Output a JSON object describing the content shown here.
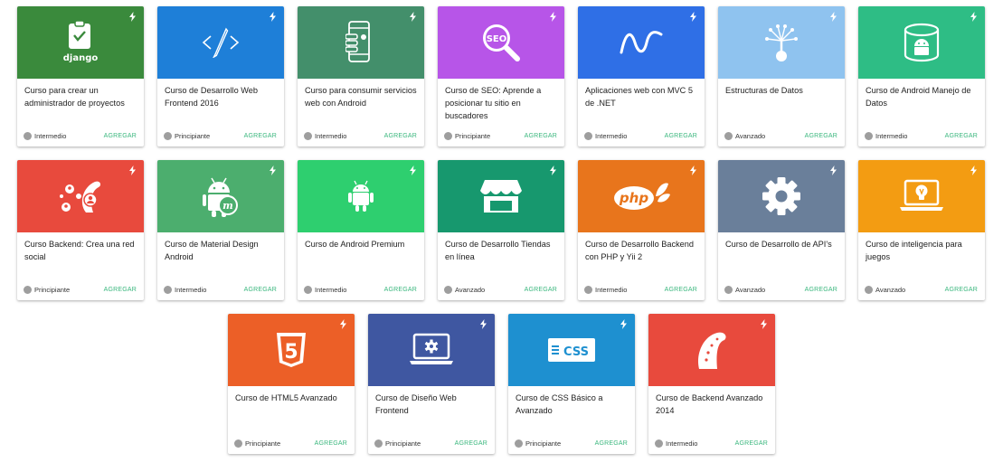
{
  "colors": {
    "django": "#3a8a3c",
    "frontend": "#1e7fd8",
    "android_consume": "#438f6b",
    "seo": "#b755e8",
    "mvc": "#2f6fe6",
    "data": "#8fc3ef",
    "android_data": "#2ebd85",
    "backend_social": "#e84a3d",
    "material": "#4cae6e",
    "android_premium": "#2ecf6f",
    "stores": "#17986e",
    "php": "#e8751c",
    "api": "#6a7f9a",
    "ai_games": "#f39c12",
    "html5": "#ec5f27",
    "design": "#3f57a1",
    "css": "#1e90d0",
    "backend_2014": "#e84a3d",
    "add_button": "#3bb77e",
    "level_dot": "#9e9e9e"
  },
  "courses": [
    {
      "title": "Curso para crear un administrador de proyectos",
      "level": "Intermedio",
      "action": "AGREGAR",
      "icon": "django-icon",
      "icon_text": "django",
      "color": "#3a8a3c"
    },
    {
      "title": "Curso de Desarrollo Web Frontend 2016",
      "level": "Principiante",
      "action": "AGREGAR",
      "icon": "code-pen-icon",
      "color": "#1e7fd8"
    },
    {
      "title": "Curso para consumir servicios web con Android",
      "level": "Intermedio",
      "action": "AGREGAR",
      "icon": "phone-icon",
      "color": "#438f6b"
    },
    {
      "title": "Curso de SEO: Aprende a posicionar tu sitio en buscadores",
      "level": "Principiante",
      "action": "AGREGAR",
      "icon": "seo-magnifier-icon",
      "icon_text": "SEO",
      "color": "#b755e8"
    },
    {
      "title": "Aplicaciones web con MVC 5 de .NET",
      "level": "Intermedio",
      "action": "AGREGAR",
      "icon": "wave-icon",
      "color": "#2f6fe6"
    },
    {
      "title": "Estructuras de Datos",
      "level": "Avanzado",
      "action": "AGREGAR",
      "icon": "tree-nodes-icon",
      "color": "#8fc3ef"
    },
    {
      "title": "Curso de Android Manejo de Datos",
      "level": "Intermedio",
      "action": "AGREGAR",
      "icon": "android-database-icon",
      "color": "#2ebd85"
    },
    {
      "title": "Curso Backend: Crea una red social",
      "level": "Principiante",
      "action": "AGREGAR",
      "icon": "social-network-icon",
      "color": "#e84a3d"
    },
    {
      "title": "Curso de Material Design Android",
      "level": "Intermedio",
      "action": "AGREGAR",
      "icon": "android-material-icon",
      "color": "#4cae6e"
    },
    {
      "title": "Curso de Android Premium",
      "level": "Intermedio",
      "action": "AGREGAR",
      "icon": "android-icon",
      "color": "#2ecf6f"
    },
    {
      "title": "Curso de Desarrollo Tiendas en línea",
      "level": "Avanzado",
      "action": "AGREGAR",
      "icon": "storefront-icon",
      "color": "#17986e"
    },
    {
      "title": "Curso de Desarrollo Backend con PHP y Yii 2",
      "level": "Intermedio",
      "action": "AGREGAR",
      "icon": "php-icon",
      "icon_text": "php",
      "color": "#e8751c"
    },
    {
      "title": "Curso de Desarrollo de API's",
      "level": "Avanzado",
      "action": "AGREGAR",
      "icon": "gear-icon",
      "color": "#6a7f9a"
    },
    {
      "title": "Curso de inteligencia para juegos",
      "level": "Avanzado",
      "action": "AGREGAR",
      "icon": "laptop-bulb-icon",
      "color": "#f39c12"
    },
    {
      "title": "Curso de HTML5 Avanzado",
      "level": "Principiante",
      "action": "AGREGAR",
      "icon": "html5-icon",
      "icon_text": "5",
      "color": "#ec5f27"
    },
    {
      "title": "Curso de Diseño Web Frontend",
      "level": "Principiante",
      "action": "AGREGAR",
      "icon": "laptop-gear-icon",
      "color": "#3f57a1"
    },
    {
      "title": "Curso de CSS Básico a Avanzado",
      "level": "Principiante",
      "action": "AGREGAR",
      "icon": "css-icon",
      "icon_text": "CSS",
      "color": "#1e90d0"
    },
    {
      "title": "Curso de Backend Avanzado 2014",
      "level": "Intermedio",
      "action": "AGREGAR",
      "icon": "tentacle-icon",
      "color": "#e84a3d"
    }
  ]
}
